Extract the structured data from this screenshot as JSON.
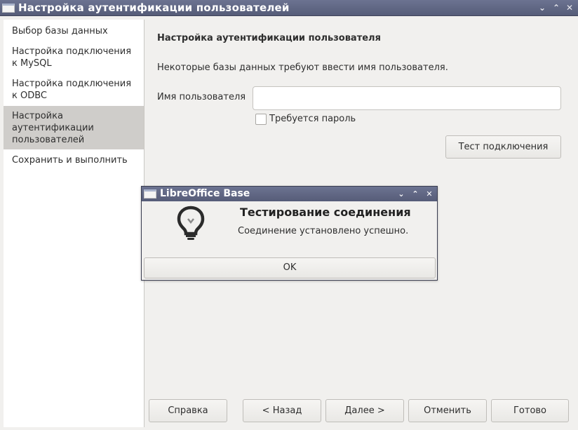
{
  "window": {
    "title": "Настройка аутентификации пользователей",
    "controls": [
      "⌄",
      "⌃",
      "✕"
    ]
  },
  "sidebar": {
    "items": [
      {
        "label": "Выбор базы данных",
        "active": false
      },
      {
        "label": "Настройка подключения к MySQL",
        "active": false
      },
      {
        "label": "Настройка подключения к ODBC",
        "active": false
      },
      {
        "label": "Настройка аутентификации пользователей",
        "active": true
      },
      {
        "label": "Сохранить и выполнить",
        "active": false
      }
    ]
  },
  "main": {
    "title": "Настройка аутентификации пользователя",
    "description": "Некоторые базы данных требуют ввести имя пользователя.",
    "username_label": "Имя пользователя",
    "username_value": "",
    "password_required_label": "Требуется пароль",
    "password_required_checked": false,
    "test_button": "Тест подключения"
  },
  "footer": {
    "help": "Справка",
    "back": "< Назад",
    "next": "Далее >",
    "cancel": "Отменить",
    "finish": "Готово"
  },
  "dialog": {
    "title": "LibreOffice Base",
    "heading": "Тестирование соединения",
    "message": "Соединение установлено успешно.",
    "ok": "OK",
    "icon": "lightbulb-icon",
    "controls": [
      "⌄",
      "⌃",
      "✕"
    ]
  },
  "colors": {
    "titlebar": "#5f6684",
    "active_item": "#cfcdca",
    "background": "#f1f0ee"
  }
}
